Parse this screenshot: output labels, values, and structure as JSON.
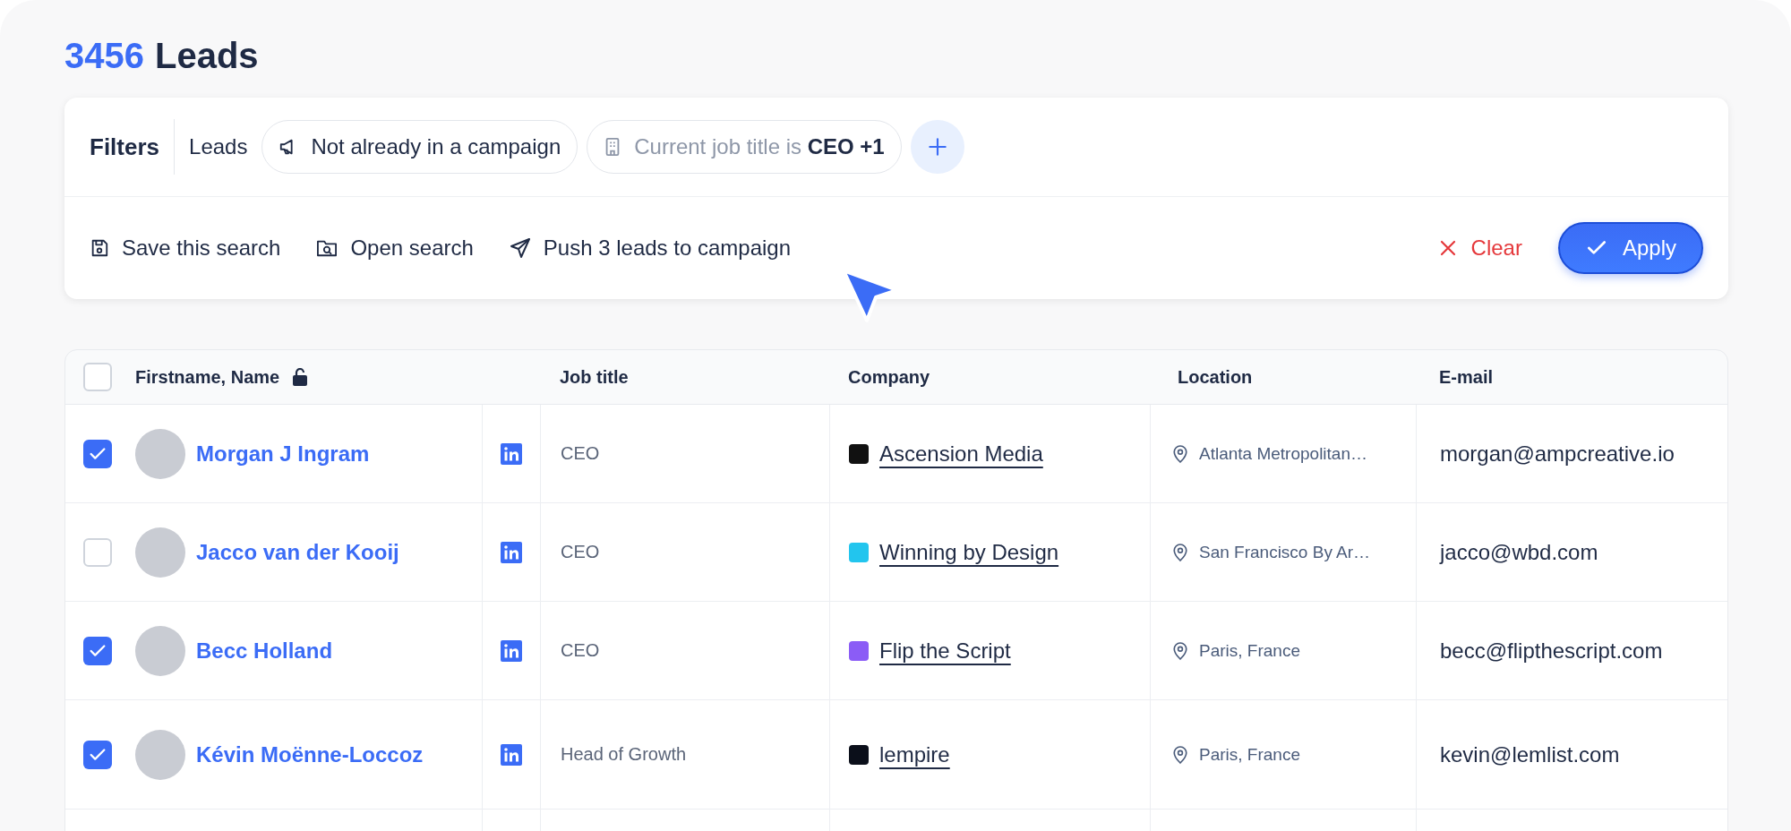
{
  "header": {
    "count": "3456",
    "title": "Leads"
  },
  "filters": {
    "label": "Filters",
    "scope": "Leads",
    "chips": [
      {
        "kind": "campaign",
        "text": "Not already in a campaign"
      },
      {
        "kind": "job",
        "text": "Current job title is **CEO +1**"
      }
    ]
  },
  "actions": [
    {
      "kind": "save",
      "label": "Save this search"
    },
    {
      "kind": "open",
      "label": "Open search"
    },
    {
      "kind": "push",
      "label": "Push 3 leads to campaign"
    }
  ],
  "clear": "Clear",
  "apply": "Apply",
  "table": {
    "header_checked": false,
    "columns": [
      "Firstname, Name",
      "Job title",
      "Company",
      "Location",
      "E-mail"
    ],
    "rows": [
      {
        "checked": true,
        "name": "Morgan J Ingram",
        "job": "CEO",
        "company": {
          "name": "Ascension Media",
          "color": "#111111"
        },
        "location": "Atlanta Metropolitan…",
        "email": "morgan@ampcreative.io"
      },
      {
        "checked": false,
        "name": "Jacco van der Kooij",
        "job": "CEO",
        "company": {
          "name": "Winning by Design",
          "color": "#22c5ee"
        },
        "location": "San Francisco By Ar…",
        "email": "jacco@wbd.com"
      },
      {
        "checked": true,
        "name": "Becc Holland",
        "job": "CEO",
        "company": {
          "name": "Flip the Script",
          "color": "#8b5cf6"
        },
        "location": "Paris, France",
        "email": "becc@flipthescript.com"
      },
      {
        "checked": true,
        "name": "Kévin Moënne-Loccoz",
        "job": "Head of Growth",
        "company": {
          "name": "lempire",
          "color": "#0b0f1a"
        },
        "location": "Paris, France",
        "email": "kevin@lemlist.com"
      }
    ]
  }
}
